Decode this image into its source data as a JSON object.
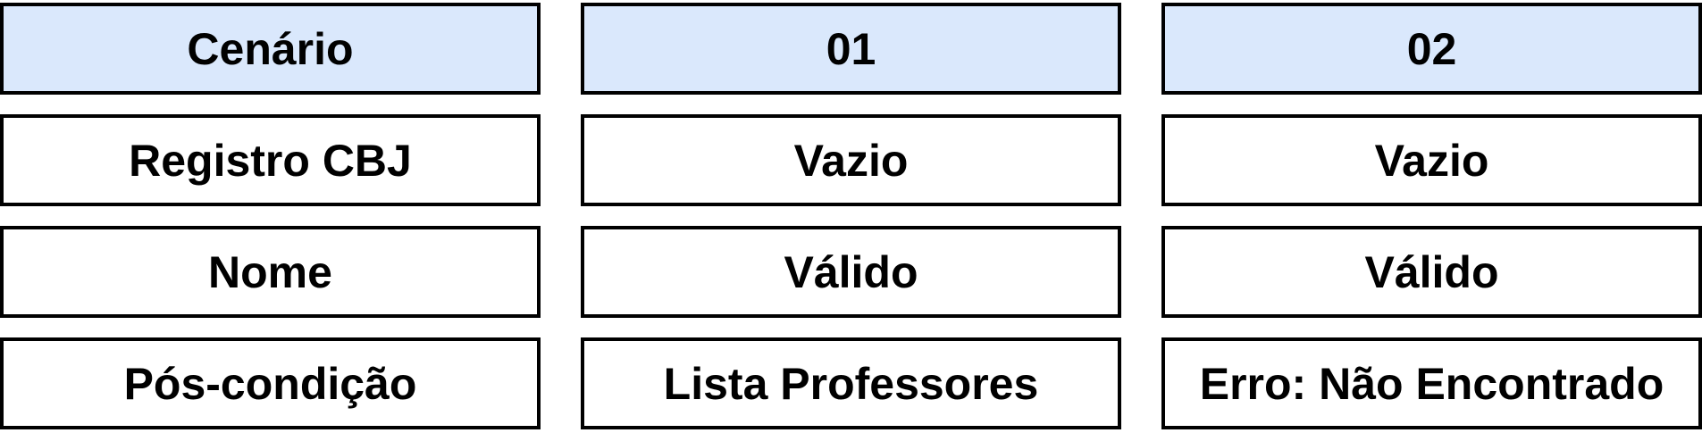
{
  "header": [
    "Cenário",
    "01",
    "02"
  ],
  "rows": [
    [
      "Registro CBJ",
      "Vazio",
      "Vazio"
    ],
    [
      "Nome",
      "Válido",
      "Válido"
    ],
    [
      "Pós-condição",
      "Lista Professores",
      "Erro: Não Encontrado"
    ]
  ],
  "colors": {
    "header_fill": "#dae8fc",
    "cell_fill": "#ffffff",
    "border": "#000000"
  }
}
